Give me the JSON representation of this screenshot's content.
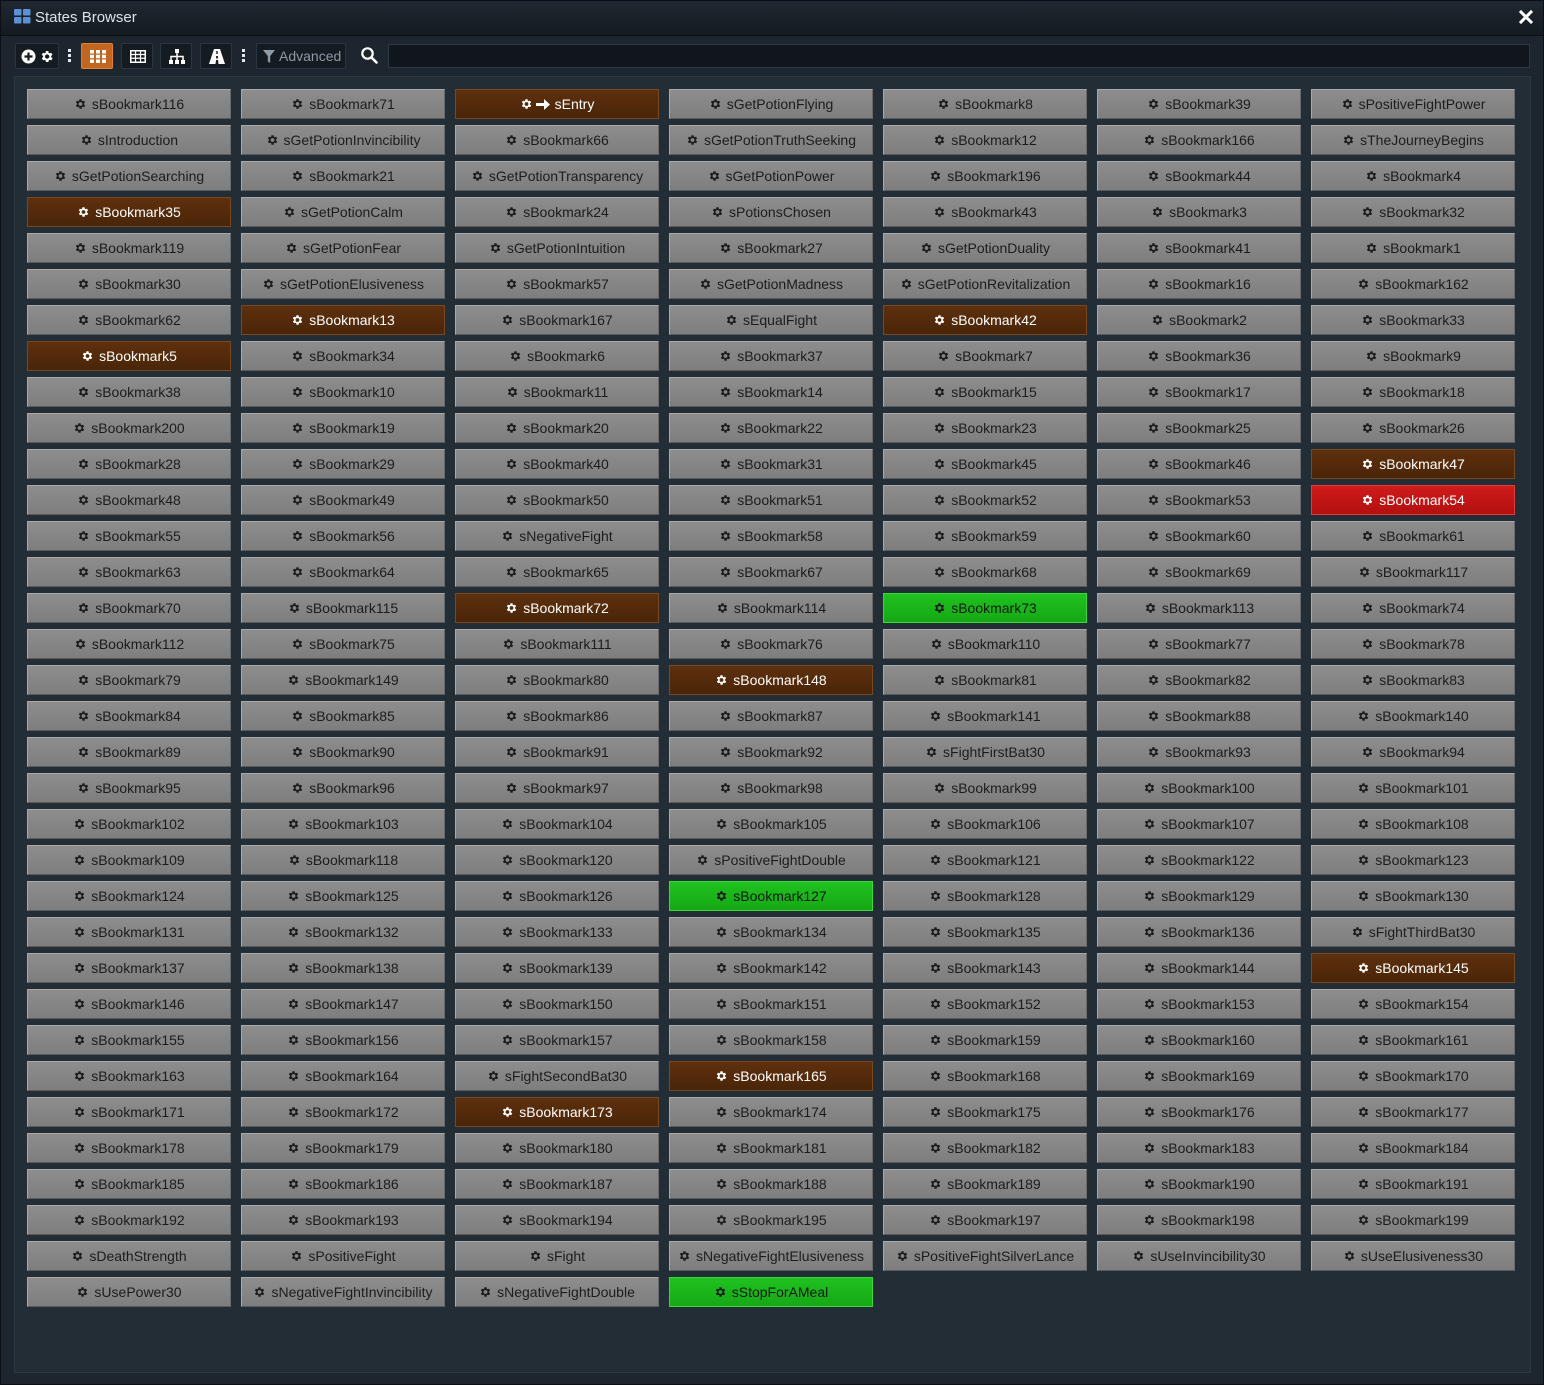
{
  "window": {
    "title": "States Browser"
  },
  "toolbar": {
    "advanced_label": "Advanced",
    "search_placeholder": ""
  },
  "colors": {
    "normal": "#858585",
    "brown": "#552a0b",
    "red": "#c41414",
    "green": "#1bb51b"
  },
  "icons": [
    "grid-view-icon",
    "add-state-icon",
    "settings-icon",
    "menu-dots-icon",
    "tile-view-icon",
    "table-view-icon",
    "hierarchy-icon",
    "road-icon",
    "filter-icon",
    "search-icon",
    "close-icon",
    "gear-icon",
    "arrow-right-icon"
  ],
  "states": [
    {
      "label": "sBookmark116",
      "color": "normal"
    },
    {
      "label": "sBookmark71",
      "color": "normal"
    },
    {
      "label": "sEntry",
      "color": "brown",
      "entry": true
    },
    {
      "label": "sGetPotionFlying",
      "color": "normal"
    },
    {
      "label": "sBookmark8",
      "color": "normal"
    },
    {
      "label": "sBookmark39",
      "color": "normal"
    },
    {
      "label": "sPositiveFightPower",
      "color": "normal"
    },
    {
      "label": "sIntroduction",
      "color": "normal"
    },
    {
      "label": "sGetPotionInvincibility",
      "color": "normal"
    },
    {
      "label": "sBookmark66",
      "color": "normal"
    },
    {
      "label": "sGetPotionTruthSeeking",
      "color": "normal"
    },
    {
      "label": "sBookmark12",
      "color": "normal"
    },
    {
      "label": "sBookmark166",
      "color": "normal"
    },
    {
      "label": "sTheJourneyBegins",
      "color": "normal"
    },
    {
      "label": "sGetPotionSearching",
      "color": "normal"
    },
    {
      "label": "sBookmark21",
      "color": "normal"
    },
    {
      "label": "sGetPotionTransparency",
      "color": "normal"
    },
    {
      "label": "sGetPotionPower",
      "color": "normal"
    },
    {
      "label": "sBookmark196",
      "color": "normal"
    },
    {
      "label": "sBookmark44",
      "color": "normal"
    },
    {
      "label": "sBookmark4",
      "color": "normal"
    },
    {
      "label": "sBookmark35",
      "color": "brown"
    },
    {
      "label": "sGetPotionCalm",
      "color": "normal"
    },
    {
      "label": "sBookmark24",
      "color": "normal"
    },
    {
      "label": "sPotionsChosen",
      "color": "normal"
    },
    {
      "label": "sBookmark43",
      "color": "normal"
    },
    {
      "label": "sBookmark3",
      "color": "normal"
    },
    {
      "label": "sBookmark32",
      "color": "normal"
    },
    {
      "label": "sBookmark119",
      "color": "normal"
    },
    {
      "label": "sGetPotionFear",
      "color": "normal"
    },
    {
      "label": "sGetPotionIntuition",
      "color": "normal"
    },
    {
      "label": "sBookmark27",
      "color": "normal"
    },
    {
      "label": "sGetPotionDuality",
      "color": "normal"
    },
    {
      "label": "sBookmark41",
      "color": "normal"
    },
    {
      "label": "sBookmark1",
      "color": "normal"
    },
    {
      "label": "sBookmark30",
      "color": "normal"
    },
    {
      "label": "sGetPotionElusiveness",
      "color": "normal"
    },
    {
      "label": "sBookmark57",
      "color": "normal"
    },
    {
      "label": "sGetPotionMadness",
      "color": "normal"
    },
    {
      "label": "sGetPotionRevitalization",
      "color": "normal"
    },
    {
      "label": "sBookmark16",
      "color": "normal"
    },
    {
      "label": "sBookmark162",
      "color": "normal"
    },
    {
      "label": "sBookmark62",
      "color": "normal"
    },
    {
      "label": "sBookmark13",
      "color": "brown"
    },
    {
      "label": "sBookmark167",
      "color": "normal"
    },
    {
      "label": "sEqualFight",
      "color": "normal"
    },
    {
      "label": "sBookmark42",
      "color": "brown"
    },
    {
      "label": "sBookmark2",
      "color": "normal"
    },
    {
      "label": "sBookmark33",
      "color": "normal"
    },
    {
      "label": "sBookmark5",
      "color": "brown"
    },
    {
      "label": "sBookmark34",
      "color": "normal"
    },
    {
      "label": "sBookmark6",
      "color": "normal"
    },
    {
      "label": "sBookmark37",
      "color": "normal"
    },
    {
      "label": "sBookmark7",
      "color": "normal"
    },
    {
      "label": "sBookmark36",
      "color": "normal"
    },
    {
      "label": "sBookmark9",
      "color": "normal"
    },
    {
      "label": "sBookmark38",
      "color": "normal"
    },
    {
      "label": "sBookmark10",
      "color": "normal"
    },
    {
      "label": "sBookmark11",
      "color": "normal"
    },
    {
      "label": "sBookmark14",
      "color": "normal"
    },
    {
      "label": "sBookmark15",
      "color": "normal"
    },
    {
      "label": "sBookmark17",
      "color": "normal"
    },
    {
      "label": "sBookmark18",
      "color": "normal"
    },
    {
      "label": "sBookmark200",
      "color": "normal"
    },
    {
      "label": "sBookmark19",
      "color": "normal"
    },
    {
      "label": "sBookmark20",
      "color": "normal"
    },
    {
      "label": "sBookmark22",
      "color": "normal"
    },
    {
      "label": "sBookmark23",
      "color": "normal"
    },
    {
      "label": "sBookmark25",
      "color": "normal"
    },
    {
      "label": "sBookmark26",
      "color": "normal"
    },
    {
      "label": "sBookmark28",
      "color": "normal"
    },
    {
      "label": "sBookmark29",
      "color": "normal"
    },
    {
      "label": "sBookmark40",
      "color": "normal"
    },
    {
      "label": "sBookmark31",
      "color": "normal"
    },
    {
      "label": "sBookmark45",
      "color": "normal"
    },
    {
      "label": "sBookmark46",
      "color": "normal"
    },
    {
      "label": "sBookmark47",
      "color": "brown"
    },
    {
      "label": "sBookmark48",
      "color": "normal"
    },
    {
      "label": "sBookmark49",
      "color": "normal"
    },
    {
      "label": "sBookmark50",
      "color": "normal"
    },
    {
      "label": "sBookmark51",
      "color": "normal"
    },
    {
      "label": "sBookmark52",
      "color": "normal"
    },
    {
      "label": "sBookmark53",
      "color": "normal"
    },
    {
      "label": "sBookmark54",
      "color": "red"
    },
    {
      "label": "sBookmark55",
      "color": "normal"
    },
    {
      "label": "sBookmark56",
      "color": "normal"
    },
    {
      "label": "sNegativeFight",
      "color": "normal"
    },
    {
      "label": "sBookmark58",
      "color": "normal"
    },
    {
      "label": "sBookmark59",
      "color": "normal"
    },
    {
      "label": "sBookmark60",
      "color": "normal"
    },
    {
      "label": "sBookmark61",
      "color": "normal"
    },
    {
      "label": "sBookmark63",
      "color": "normal"
    },
    {
      "label": "sBookmark64",
      "color": "normal"
    },
    {
      "label": "sBookmark65",
      "color": "normal"
    },
    {
      "label": "sBookmark67",
      "color": "normal"
    },
    {
      "label": "sBookmark68",
      "color": "normal"
    },
    {
      "label": "sBookmark69",
      "color": "normal"
    },
    {
      "label": "sBookmark117",
      "color": "normal"
    },
    {
      "label": "sBookmark70",
      "color": "normal"
    },
    {
      "label": "sBookmark115",
      "color": "normal"
    },
    {
      "label": "sBookmark72",
      "color": "brown"
    },
    {
      "label": "sBookmark114",
      "color": "normal"
    },
    {
      "label": "sBookmark73",
      "color": "green"
    },
    {
      "label": "sBookmark113",
      "color": "normal"
    },
    {
      "label": "sBookmark74",
      "color": "normal"
    },
    {
      "label": "sBookmark112",
      "color": "normal"
    },
    {
      "label": "sBookmark75",
      "color": "normal"
    },
    {
      "label": "sBookmark111",
      "color": "normal"
    },
    {
      "label": "sBookmark76",
      "color": "normal"
    },
    {
      "label": "sBookmark110",
      "color": "normal"
    },
    {
      "label": "sBookmark77",
      "color": "normal"
    },
    {
      "label": "sBookmark78",
      "color": "normal"
    },
    {
      "label": "sBookmark79",
      "color": "normal"
    },
    {
      "label": "sBookmark149",
      "color": "normal"
    },
    {
      "label": "sBookmark80",
      "color": "normal"
    },
    {
      "label": "sBookmark148",
      "color": "brown"
    },
    {
      "label": "sBookmark81",
      "color": "normal"
    },
    {
      "label": "sBookmark82",
      "color": "normal"
    },
    {
      "label": "sBookmark83",
      "color": "normal"
    },
    {
      "label": "sBookmark84",
      "color": "normal"
    },
    {
      "label": "sBookmark85",
      "color": "normal"
    },
    {
      "label": "sBookmark86",
      "color": "normal"
    },
    {
      "label": "sBookmark87",
      "color": "normal"
    },
    {
      "label": "sBookmark141",
      "color": "normal"
    },
    {
      "label": "sBookmark88",
      "color": "normal"
    },
    {
      "label": "sBookmark140",
      "color": "normal"
    },
    {
      "label": "sBookmark89",
      "color": "normal"
    },
    {
      "label": "sBookmark90",
      "color": "normal"
    },
    {
      "label": "sBookmark91",
      "color": "normal"
    },
    {
      "label": "sBookmark92",
      "color": "normal"
    },
    {
      "label": "sFightFirstBat30",
      "color": "normal"
    },
    {
      "label": "sBookmark93",
      "color": "normal"
    },
    {
      "label": "sBookmark94",
      "color": "normal"
    },
    {
      "label": "sBookmark95",
      "color": "normal"
    },
    {
      "label": "sBookmark96",
      "color": "normal"
    },
    {
      "label": "sBookmark97",
      "color": "normal"
    },
    {
      "label": "sBookmark98",
      "color": "normal"
    },
    {
      "label": "sBookmark99",
      "color": "normal"
    },
    {
      "label": "sBookmark100",
      "color": "normal"
    },
    {
      "label": "sBookmark101",
      "color": "normal"
    },
    {
      "label": "sBookmark102",
      "color": "normal"
    },
    {
      "label": "sBookmark103",
      "color": "normal"
    },
    {
      "label": "sBookmark104",
      "color": "normal"
    },
    {
      "label": "sBookmark105",
      "color": "normal"
    },
    {
      "label": "sBookmark106",
      "color": "normal"
    },
    {
      "label": "sBookmark107",
      "color": "normal"
    },
    {
      "label": "sBookmark108",
      "color": "normal"
    },
    {
      "label": "sBookmark109",
      "color": "normal"
    },
    {
      "label": "sBookmark118",
      "color": "normal"
    },
    {
      "label": "sBookmark120",
      "color": "normal"
    },
    {
      "label": "sPositiveFightDouble",
      "color": "normal"
    },
    {
      "label": "sBookmark121",
      "color": "normal"
    },
    {
      "label": "sBookmark122",
      "color": "normal"
    },
    {
      "label": "sBookmark123",
      "color": "normal"
    },
    {
      "label": "sBookmark124",
      "color": "normal"
    },
    {
      "label": "sBookmark125",
      "color": "normal"
    },
    {
      "label": "sBookmark126",
      "color": "normal"
    },
    {
      "label": "sBookmark127",
      "color": "green"
    },
    {
      "label": "sBookmark128",
      "color": "normal"
    },
    {
      "label": "sBookmark129",
      "color": "normal"
    },
    {
      "label": "sBookmark130",
      "color": "normal"
    },
    {
      "label": "sBookmark131",
      "color": "normal"
    },
    {
      "label": "sBookmark132",
      "color": "normal"
    },
    {
      "label": "sBookmark133",
      "color": "normal"
    },
    {
      "label": "sBookmark134",
      "color": "normal"
    },
    {
      "label": "sBookmark135",
      "color": "normal"
    },
    {
      "label": "sBookmark136",
      "color": "normal"
    },
    {
      "label": "sFightThirdBat30",
      "color": "normal"
    },
    {
      "label": "sBookmark137",
      "color": "normal"
    },
    {
      "label": "sBookmark138",
      "color": "normal"
    },
    {
      "label": "sBookmark139",
      "color": "normal"
    },
    {
      "label": "sBookmark142",
      "color": "normal"
    },
    {
      "label": "sBookmark143",
      "color": "normal"
    },
    {
      "label": "sBookmark144",
      "color": "normal"
    },
    {
      "label": "sBookmark145",
      "color": "brown"
    },
    {
      "label": "sBookmark146",
      "color": "normal"
    },
    {
      "label": "sBookmark147",
      "color": "normal"
    },
    {
      "label": "sBookmark150",
      "color": "normal"
    },
    {
      "label": "sBookmark151",
      "color": "normal"
    },
    {
      "label": "sBookmark152",
      "color": "normal"
    },
    {
      "label": "sBookmark153",
      "color": "normal"
    },
    {
      "label": "sBookmark154",
      "color": "normal"
    },
    {
      "label": "sBookmark155",
      "color": "normal"
    },
    {
      "label": "sBookmark156",
      "color": "normal"
    },
    {
      "label": "sBookmark157",
      "color": "normal"
    },
    {
      "label": "sBookmark158",
      "color": "normal"
    },
    {
      "label": "sBookmark159",
      "color": "normal"
    },
    {
      "label": "sBookmark160",
      "color": "normal"
    },
    {
      "label": "sBookmark161",
      "color": "normal"
    },
    {
      "label": "sBookmark163",
      "color": "normal"
    },
    {
      "label": "sBookmark164",
      "color": "normal"
    },
    {
      "label": "sFightSecondBat30",
      "color": "normal"
    },
    {
      "label": "sBookmark165",
      "color": "brown"
    },
    {
      "label": "sBookmark168",
      "color": "normal"
    },
    {
      "label": "sBookmark169",
      "color": "normal"
    },
    {
      "label": "sBookmark170",
      "color": "normal"
    },
    {
      "label": "sBookmark171",
      "color": "normal"
    },
    {
      "label": "sBookmark172",
      "color": "normal"
    },
    {
      "label": "sBookmark173",
      "color": "brown"
    },
    {
      "label": "sBookmark174",
      "color": "normal"
    },
    {
      "label": "sBookmark175",
      "color": "normal"
    },
    {
      "label": "sBookmark176",
      "color": "normal"
    },
    {
      "label": "sBookmark177",
      "color": "normal"
    },
    {
      "label": "sBookmark178",
      "color": "normal"
    },
    {
      "label": "sBookmark179",
      "color": "normal"
    },
    {
      "label": "sBookmark180",
      "color": "normal"
    },
    {
      "label": "sBookmark181",
      "color": "normal"
    },
    {
      "label": "sBookmark182",
      "color": "normal"
    },
    {
      "label": "sBookmark183",
      "color": "normal"
    },
    {
      "label": "sBookmark184",
      "color": "normal"
    },
    {
      "label": "sBookmark185",
      "color": "normal"
    },
    {
      "label": "sBookmark186",
      "color": "normal"
    },
    {
      "label": "sBookmark187",
      "color": "normal"
    },
    {
      "label": "sBookmark188",
      "color": "normal"
    },
    {
      "label": "sBookmark189",
      "color": "normal"
    },
    {
      "label": "sBookmark190",
      "color": "normal"
    },
    {
      "label": "sBookmark191",
      "color": "normal"
    },
    {
      "label": "sBookmark192",
      "color": "normal"
    },
    {
      "label": "sBookmark193",
      "color": "normal"
    },
    {
      "label": "sBookmark194",
      "color": "normal"
    },
    {
      "label": "sBookmark195",
      "color": "normal"
    },
    {
      "label": "sBookmark197",
      "color": "normal"
    },
    {
      "label": "sBookmark198",
      "color": "normal"
    },
    {
      "label": "sBookmark199",
      "color": "normal"
    },
    {
      "label": "sDeathStrength",
      "color": "normal"
    },
    {
      "label": "sPositiveFight",
      "color": "normal"
    },
    {
      "label": "sFight",
      "color": "normal"
    },
    {
      "label": "sNegativeFightElusiveness",
      "color": "normal"
    },
    {
      "label": "sPositiveFightSilverLance",
      "color": "normal"
    },
    {
      "label": "sUseInvincibility30",
      "color": "normal"
    },
    {
      "label": "sUseElusiveness30",
      "color": "normal"
    },
    {
      "label": "sUsePower30",
      "color": "normal"
    },
    {
      "label": "sNegativeFightInvincibility",
      "color": "normal"
    },
    {
      "label": "sNegativeFightDouble",
      "color": "normal"
    },
    {
      "label": "sStopForAMeal",
      "color": "green"
    }
  ]
}
